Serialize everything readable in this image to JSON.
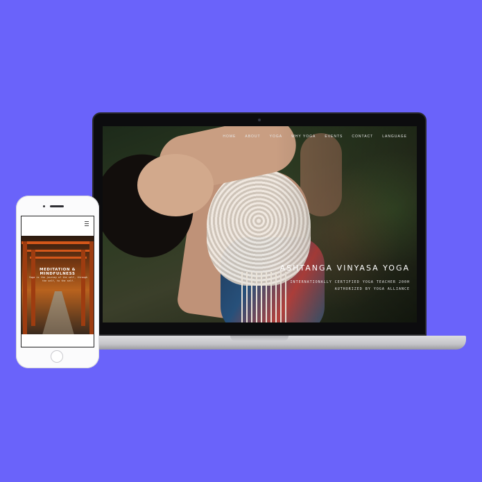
{
  "laptop": {
    "nav": [
      "Home",
      "About",
      "Yoga",
      "Why Yoga",
      "Events",
      "Contact",
      "Language"
    ],
    "hero_title": "ASHTANGA VINYASA YOGA",
    "hero_subtitle_line1": "INTERNATIONALLY CERTIFIED YOGA TEACHER 200H",
    "hero_subtitle_line2": "AUTHORIZED BY YOGA ALLIANCE"
  },
  "phone": {
    "hero_title": "MEDITATION & MINDFULNESS",
    "hero_subtitle": "Yoga is the journey of the self, through the self, to the self."
  },
  "colors": {
    "background": "#6a63fa",
    "laptop_bezel": "#0c0c0e",
    "device_silver": "#c5c5c9"
  },
  "icons": [
    "camera-icon",
    "hamburger-menu-icon",
    "home-button-icon"
  ]
}
